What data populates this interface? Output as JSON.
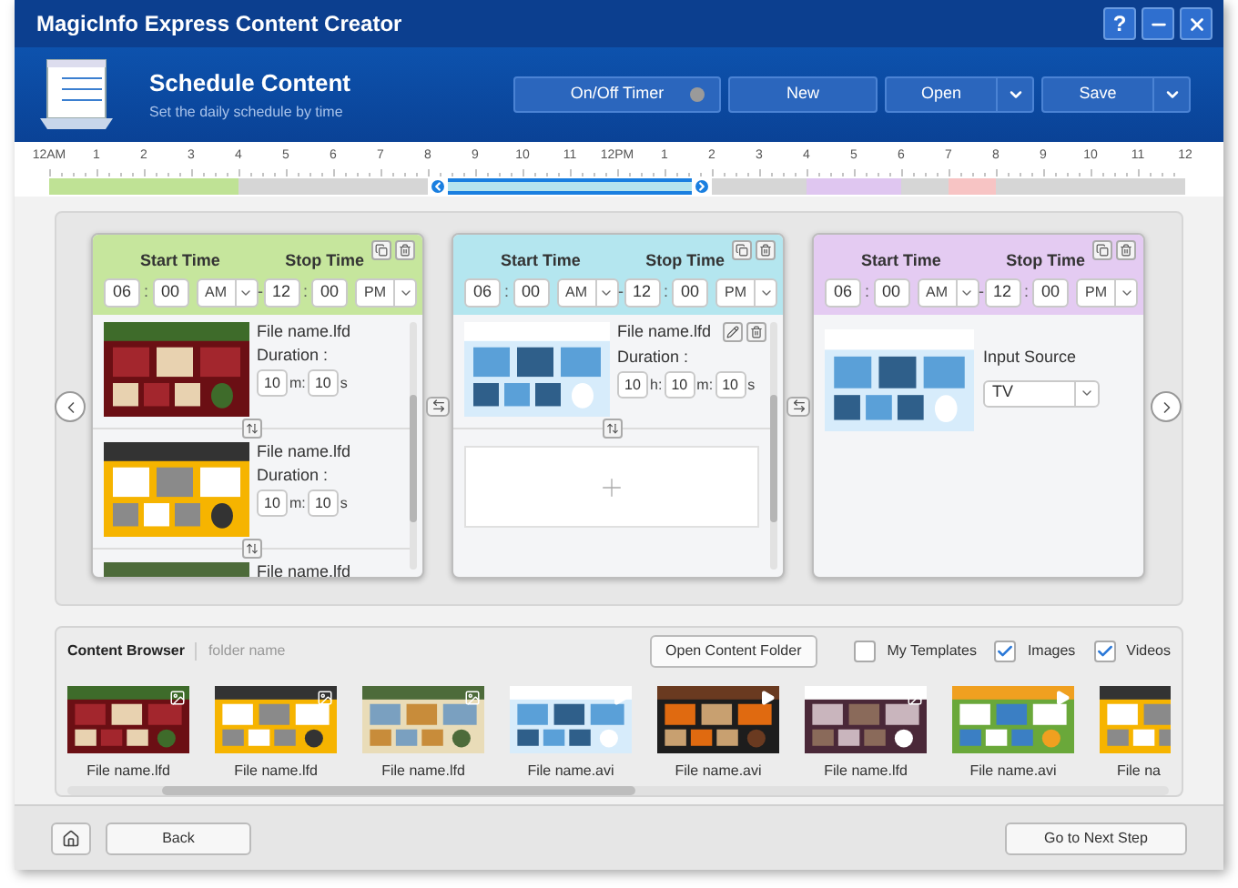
{
  "window": {
    "title": "MagicInfo Express Content Creator",
    "help": "?"
  },
  "header": {
    "title": "Schedule Content",
    "subtitle": "Set the daily schedule by time",
    "buttons": [
      {
        "label": "On/Off Timer",
        "kind": "timer",
        "on": false
      },
      {
        "label": "New",
        "kind": "plain"
      },
      {
        "label": "Open",
        "kind": "split"
      },
      {
        "label": "Save",
        "kind": "split"
      }
    ]
  },
  "timeline": {
    "labels": [
      "12AM",
      "1",
      "2",
      "3",
      "4",
      "5",
      "6",
      "7",
      "8",
      "9",
      "10",
      "11",
      "12PM",
      "1",
      "2",
      "3",
      "4",
      "5",
      "6",
      "7",
      "8",
      "9",
      "10",
      "11",
      "12"
    ],
    "slots": [
      {
        "color": "#bfe295",
        "selected": false
      },
      {
        "color": "#bfe295",
        "selected": false
      },
      {
        "color": "#bfe295",
        "selected": false
      },
      {
        "color": "#bfe295",
        "selected": false
      },
      {
        "color": "#d6d6d6",
        "selected": false
      },
      {
        "color": "#d6d6d6",
        "selected": false
      },
      {
        "color": "#d6d6d6",
        "selected": false
      },
      {
        "color": "#d6d6d6",
        "selected": false
      },
      {
        "color": "#b5e4ee",
        "selected": true
      },
      {
        "color": "#b5e4ee",
        "selected": true
      },
      {
        "color": "#b5e4ee",
        "selected": true
      },
      {
        "color": "#b5e4ee",
        "selected": true
      },
      {
        "color": "#b5e4ee",
        "selected": true
      },
      {
        "color": "#b5e4ee",
        "selected": true
      },
      {
        "color": "#d6d6d6",
        "selected": false
      },
      {
        "color": "#d6d6d6",
        "selected": false
      },
      {
        "color": "#dfc6f0",
        "selected": false
      },
      {
        "color": "#dfc6f0",
        "selected": false
      },
      {
        "color": "#d6d6d6",
        "selected": false
      },
      {
        "color": "#f7c4c4",
        "selected": false
      },
      {
        "color": "#d6d6d6",
        "selected": false
      },
      {
        "color": "#d6d6d6",
        "selected": false
      },
      {
        "color": "#d6d6d6",
        "selected": false
      },
      {
        "color": "#d6d6d6",
        "selected": false
      }
    ]
  },
  "schedules": [
    {
      "color": "#c6e69d",
      "start_label": "Start Time",
      "stop_label": "Stop Time",
      "start": {
        "hour": "06",
        "sep": ":",
        "minute": "00",
        "ampm": "AM"
      },
      "dash": "-",
      "stop": {
        "hour": "12",
        "sep": ":",
        "minute": "00",
        "ampm": "PM"
      },
      "kind": "contents",
      "items": [
        {
          "kind": "file",
          "name": "File name.lfd",
          "duration_label": "Duration :",
          "editable": false,
          "duration": [
            {
              "value": "10",
              "unit": "m:"
            },
            {
              "value": "10",
              "unit": "s"
            }
          ]
        },
        {
          "kind": "file",
          "name": "File name.lfd",
          "duration_label": "Duration :",
          "editable": false,
          "duration": [
            {
              "value": "10",
              "unit": "m:"
            },
            {
              "value": "10",
              "unit": "s"
            }
          ]
        },
        {
          "kind": "file",
          "name": "File name.lfd",
          "editable": false
        }
      ]
    },
    {
      "color": "#b4e6ef",
      "start_label": "Start Time",
      "stop_label": "Stop Time",
      "start": {
        "hour": "06",
        "sep": ":",
        "minute": "00",
        "ampm": "AM"
      },
      "dash": "-",
      "stop": {
        "hour": "12",
        "sep": ":",
        "minute": "00",
        "ampm": "PM"
      },
      "kind": "contents",
      "items": [
        {
          "kind": "file",
          "name": "File name.lfd",
          "duration_label": "Duration :",
          "editable": true,
          "duration": [
            {
              "value": "10",
              "unit": "h:"
            },
            {
              "value": "10",
              "unit": "m:"
            },
            {
              "value": "10",
              "unit": "s"
            }
          ]
        },
        {
          "kind": "add"
        }
      ]
    },
    {
      "color": "#e4cbf2",
      "start_label": "Start Time",
      "stop_label": "Stop Time",
      "start": {
        "hour": "06",
        "sep": ":",
        "minute": "00",
        "ampm": "AM"
      },
      "dash": "-",
      "stop": {
        "hour": "12",
        "sep": ":",
        "minute": "00",
        "ampm": "PM"
      },
      "kind": "input",
      "input_label": "Input Source",
      "input_value": "TV"
    }
  ],
  "content_browser": {
    "title": "Content Browser",
    "folder": "folder name",
    "open_button": "Open Content Folder",
    "filters": [
      {
        "label": "My Templates",
        "checked": false
      },
      {
        "label": "Images",
        "checked": true
      },
      {
        "label": "Videos",
        "checked": true
      }
    ],
    "files": [
      {
        "name": "File name.lfd",
        "kind": "lfd"
      },
      {
        "name": "File name.lfd",
        "kind": "lfd"
      },
      {
        "name": "File name.lfd",
        "kind": "lfd"
      },
      {
        "name": "File name.avi",
        "kind": "avi"
      },
      {
        "name": "File name.avi",
        "kind": "avi"
      },
      {
        "name": "File name.lfd",
        "kind": "lfd"
      },
      {
        "name": "File name.avi",
        "kind": "avi"
      },
      {
        "name": "File na",
        "kind": "cut"
      }
    ]
  },
  "footer": {
    "back": "Back",
    "next": "Go to Next Step"
  }
}
